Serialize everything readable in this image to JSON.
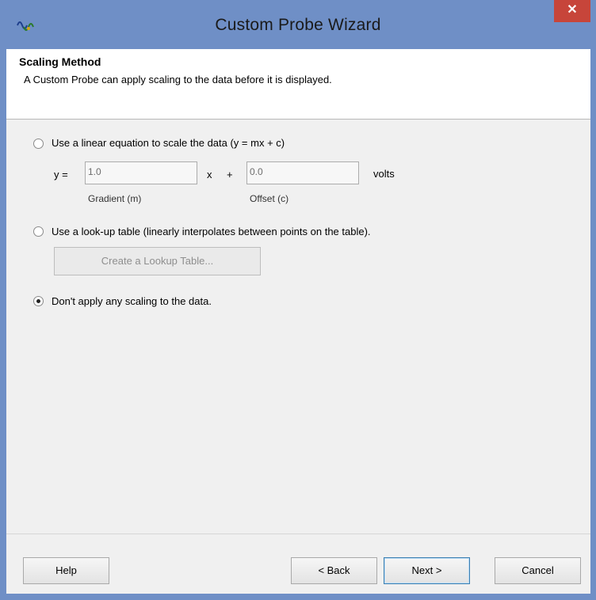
{
  "window": {
    "title": "Custom Probe Wizard",
    "close_symbol": "✕"
  },
  "header": {
    "title": "Scaling Method",
    "subtitle": "A Custom Probe can apply scaling to the data before it is displayed."
  },
  "options": {
    "linear": {
      "label": "Use a linear equation to scale the data (y = mx + c)",
      "selected": false,
      "y_label": "y  =",
      "gradient_value": "1.0",
      "x_label": "x",
      "plus_label": "+",
      "offset_value": "0.0",
      "unit_label": "volts",
      "gradient_caption": "Gradient (m)",
      "offset_caption": "Offset (c)"
    },
    "lookup": {
      "label": "Use a look-up table (linearly interpolates between points on the table).",
      "selected": false,
      "button_label": "Create a Lookup Table..."
    },
    "none": {
      "label": "Don't apply any scaling to the data.",
      "selected": true
    }
  },
  "footer": {
    "help_label": "Help",
    "back_label": "< Back",
    "next_label": "Next >",
    "cancel_label": "Cancel"
  },
  "icons": {
    "app": "waveform-app-icon"
  },
  "colors": {
    "titlebar": "#6f8fc6",
    "close": "#c7453a"
  }
}
